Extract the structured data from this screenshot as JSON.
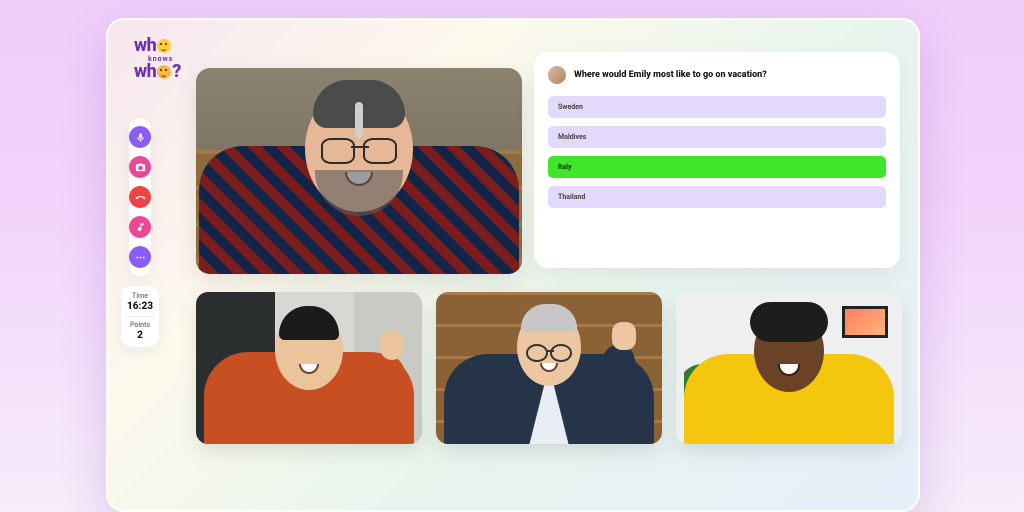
{
  "logo": {
    "line1": "wh",
    "mid": "knows",
    "line2": "wh",
    "q": "?"
  },
  "sidebar": {
    "icons": [
      "mic-icon",
      "camera-icon",
      "hangup-icon",
      "music-icon",
      "more-icon"
    ],
    "time_label": "Time",
    "time_value": "16:23",
    "points_label": "Points",
    "points_value": "2"
  },
  "question": {
    "text": "Where would Emily most like to go on vacation?",
    "options": [
      {
        "label": "Sweden",
        "correct": false
      },
      {
        "label": "Maldives",
        "correct": false
      },
      {
        "label": "Italy",
        "correct": true
      },
      {
        "label": "Thailand",
        "correct": false
      }
    ]
  }
}
